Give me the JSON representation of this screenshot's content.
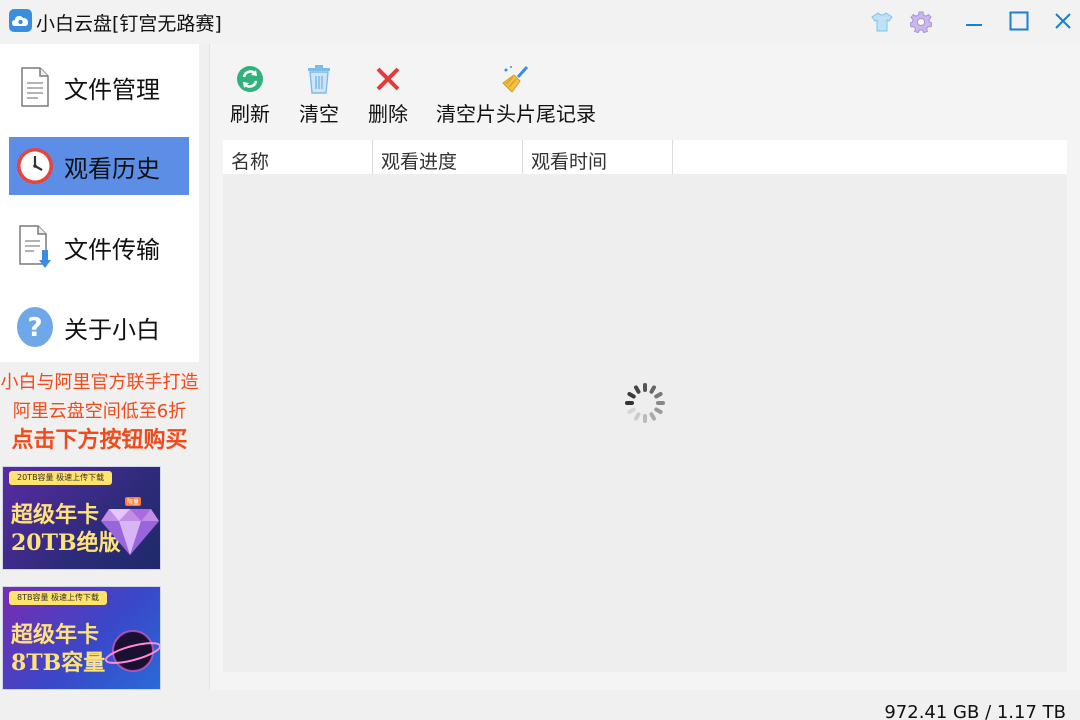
{
  "window": {
    "title": "小白云盘[钉宫无路赛]"
  },
  "sidebar": {
    "items": [
      {
        "label": "文件管理",
        "icon": "document-icon"
      },
      {
        "label": "观看历史",
        "icon": "clock-icon"
      },
      {
        "label": "文件传输",
        "icon": "download-document-icon"
      },
      {
        "label": "关于小白",
        "icon": "help-icon"
      }
    ],
    "active_index": 1
  },
  "promo": {
    "line1": "小白与阿里官方联手打造",
    "line2": "阿里云盘空间低至6折",
    "line3": "点击下方按钮购买"
  },
  "banners": [
    {
      "strip": "20TB容量 极速上传下载",
      "line1": "超级年卡",
      "line2": "20TB绝版",
      "tag": "限量"
    },
    {
      "strip": "8TB容量 极速上传下载",
      "line1": "超级年卡",
      "line2": "8TB容量"
    }
  ],
  "toolbar": {
    "refresh": "刷新",
    "clear": "清空",
    "delete": "删除",
    "clear_intro_outro": "清空片头片尾记录"
  },
  "table": {
    "columns": [
      "名称",
      "观看进度",
      "观看时间"
    ]
  },
  "status": {
    "storage": "972.41 GB / 1.17 TB"
  },
  "colors": {
    "accent": "#5c8ee6",
    "promo_text": "#f04a1a",
    "refresh_green": "#2fb37a",
    "delete_red": "#e23b3b"
  }
}
